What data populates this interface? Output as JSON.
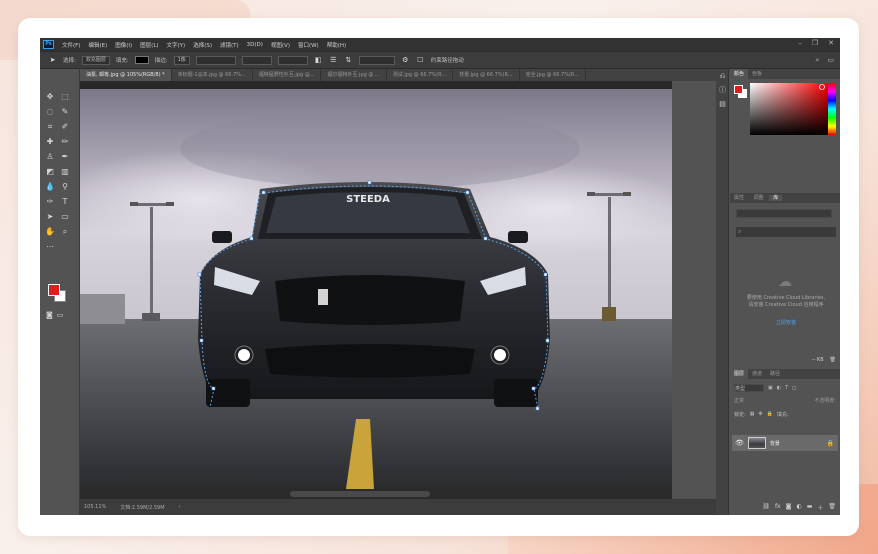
{
  "menu": [
    "文件(F)",
    "编辑(E)",
    "图像(I)",
    "图层(L)",
    "文字(Y)",
    "选择(S)",
    "滤镜(T)",
    "3D(D)",
    "视图(V)",
    "窗口(W)",
    "帮助(H)"
  ],
  "app_logo": "Ps",
  "window_controls": [
    "–",
    "❐",
    "✕"
  ],
  "options": {
    "select_label": "选择:",
    "select_value": "双充图层",
    "fill_label": "填充:",
    "stroke_label": "描边:",
    "stroke_value": "1像",
    "constrain_label": "约束路径拖动"
  },
  "tabs": [
    "油泵, 邮筹.jpg @ 105%(RGB/8) *",
    "未标题-1@本.jpg @ 66.7%...",
    "福特猛野性外互.jpg @...",
    "福尔福特外互.jpg @ ...",
    "测试.jpg @ 66.7%(R...",
    "背景.jpg @ 66.7%(R...",
    "完全.jpg @ 66.7%(R..."
  ],
  "status": {
    "zoom": "105.11%",
    "doc": "文档:2.59M/2.59M"
  },
  "color_panel_tabs": [
    "颜色",
    "色板"
  ],
  "libraries_panel_tabs": [
    "属性",
    "调整",
    "库"
  ],
  "library_tab": "库",
  "cc_text_1": "要使用 Creative Cloud Libraries,",
  "cc_text_2": "请安装 Creative Cloud 应用程序",
  "cc_link": "立即安装",
  "library_size": "-- KB",
  "layers_tabs": [
    "图层",
    "通道",
    "路径"
  ],
  "layers_filter": "类型",
  "layers_mode": "正常",
  "layers_opacity": "不透明度:",
  "layers_lock": "锁定:",
  "layers_fill": "填充:",
  "layer": {
    "name": "背景"
  },
  "car_plate_text": "STEEDA"
}
